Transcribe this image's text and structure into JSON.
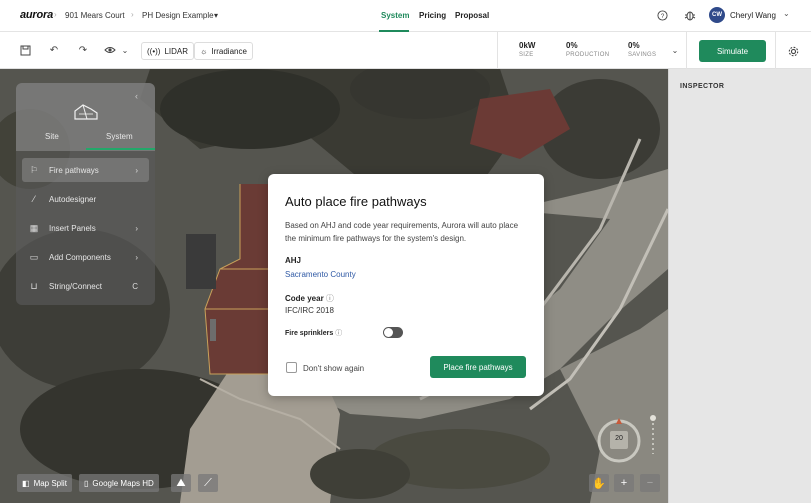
{
  "header": {
    "logo": "aurora",
    "breadcrumb": [
      "901 Mears Court",
      "PH Design Example"
    ],
    "design_dropdown_caret": "▾",
    "nav_tabs": [
      {
        "label": "System",
        "active": true
      },
      {
        "label": "Pricing",
        "active": false
      },
      {
        "label": "Proposal",
        "active": false
      }
    ],
    "user": {
      "initials": "CW",
      "name": "Cheryl Wang"
    }
  },
  "toolbar": {
    "lidar_label": "LIDAR",
    "irradiance_label": "Irradiance",
    "metrics": [
      {
        "value": "0kW",
        "label": "SIZE"
      },
      {
        "value": "0%",
        "label": "PRODUCTION"
      },
      {
        "value": "0%",
        "label": "SAVINGS"
      }
    ],
    "simulate_label": "Simulate"
  },
  "left_panel": {
    "tabs": [
      {
        "label": "Site",
        "active": false
      },
      {
        "label": "System",
        "active": true
      }
    ],
    "items": [
      {
        "label": "Fire pathways",
        "icon": "fire-pathways-icon",
        "has_chevron": true,
        "active": true
      },
      {
        "label": "Autodesigner",
        "icon": "magic-wand-icon",
        "has_chevron": false,
        "active": false
      },
      {
        "label": "Insert Panels",
        "icon": "panel-grid-icon",
        "has_chevron": true,
        "active": false
      },
      {
        "label": "Add Components",
        "icon": "component-icon",
        "has_chevron": true,
        "active": false
      },
      {
        "label": "String/Connect",
        "icon": "string-icon",
        "shortcut": "C",
        "active": false
      }
    ]
  },
  "inspector": {
    "title": "INSPECTOR"
  },
  "modal": {
    "title": "Auto place fire pathways",
    "description": "Based on AHJ and code year requirements, Aurora will auto place the minimum fire pathways for the system's design.",
    "ahj_label": "AHJ",
    "ahj_value": "Sacramento County",
    "code_year_label": "Code year",
    "code_year_value": "IFC/IRC 2018",
    "sprinklers_label": "Fire sprinklers",
    "sprinklers_on": false,
    "dont_show_label": "Don't show again",
    "primary_button": "Place fire pathways"
  },
  "map_controls": {
    "map_split": "Map Split",
    "imagery": "Google Maps HD",
    "compass_value": "20"
  },
  "colors": {
    "accent": "#1f8a5c",
    "link": "#2f59a5"
  }
}
